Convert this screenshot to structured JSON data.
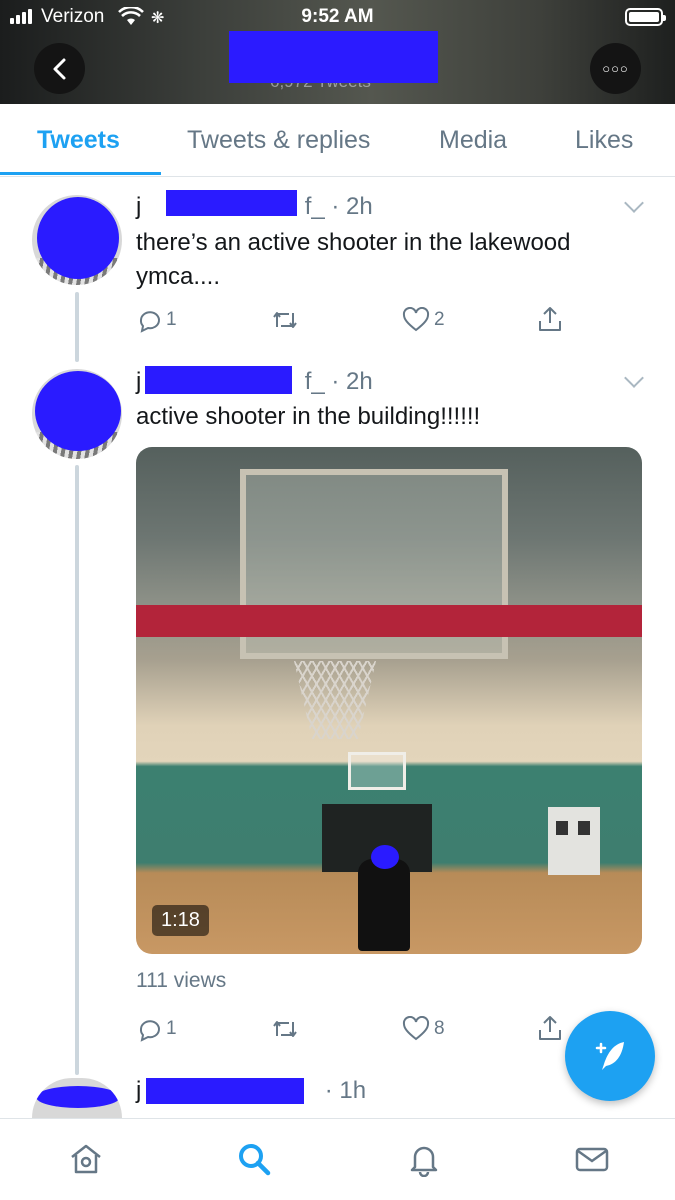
{
  "status_bar": {
    "carrier": "Verizon",
    "time": "9:52 AM"
  },
  "header": {
    "tweet_count": "6,972 Tweets"
  },
  "tabs": [
    {
      "label": "Tweets",
      "active": true
    },
    {
      "label": "Tweets & replies",
      "active": false
    },
    {
      "label": "Media",
      "active": false
    },
    {
      "label": "Likes",
      "active": false
    }
  ],
  "tweets": [
    {
      "handle_start": "j",
      "handle_end": "f_",
      "time": "2h",
      "text_line1": "there’s an active shooter in the lakewood",
      "text_line2": "ymca....",
      "replies": "1",
      "retweets": "",
      "likes": "2"
    },
    {
      "handle_start": "j",
      "handle_end": "f_",
      "time": "2h",
      "text_line1": "active shooter in the building!!!!!!",
      "video_duration": "1:18",
      "views": "111 views",
      "replies": "1",
      "retweets": "",
      "likes": "8"
    },
    {
      "handle_start": "j",
      "time": "1h"
    }
  ],
  "bottom_nav": [
    "home-icon",
    "search-icon",
    "notifications-icon",
    "messages-icon"
  ],
  "colors": {
    "accent": "#1da1f2",
    "redaction": "#2a1bff",
    "muted": "#657786"
  }
}
